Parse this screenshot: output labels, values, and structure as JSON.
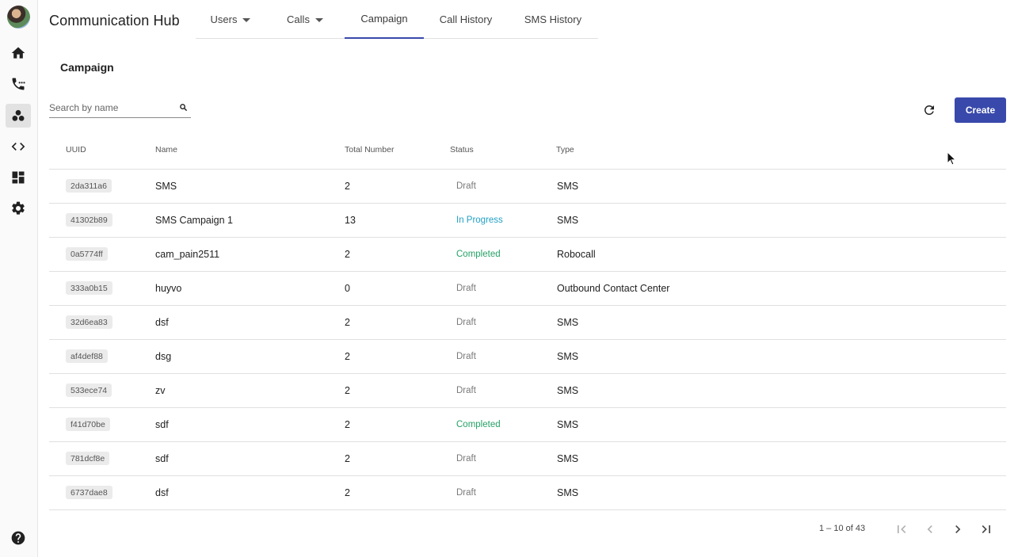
{
  "app": {
    "title": "Communication Hub"
  },
  "sidebar": {
    "items": [
      {
        "icon": "home-icon"
      },
      {
        "icon": "phone-dialpad-icon"
      },
      {
        "icon": "campaign-bubbles-icon"
      },
      {
        "icon": "code-icon"
      },
      {
        "icon": "dashboard-icon"
      },
      {
        "icon": "gear-icon"
      },
      {
        "icon": "help-icon"
      }
    ]
  },
  "tabs": [
    {
      "label": "Users",
      "dropdown": true
    },
    {
      "label": "Calls",
      "dropdown": true
    },
    {
      "label": "Campaign",
      "active": true
    },
    {
      "label": "Call History"
    },
    {
      "label": "SMS History"
    }
  ],
  "page": {
    "title": "Campaign"
  },
  "search": {
    "placeholder": "Search by name",
    "value": ""
  },
  "toolbar": {
    "create_label": "Create"
  },
  "table": {
    "headers": {
      "uuid": "UUID",
      "name": "Name",
      "total": "Total Number",
      "status": "Status",
      "type": "Type"
    },
    "rows": [
      {
        "uuid": "2da311a6",
        "name": "SMS",
        "total": "2",
        "status": "Draft",
        "type": "SMS"
      },
      {
        "uuid": "41302b89",
        "name": "SMS Campaign 1",
        "total": "13",
        "status": "In Progress",
        "type": "SMS"
      },
      {
        "uuid": "0a5774ff",
        "name": "cam_pain2511",
        "total": "2",
        "status": "Completed",
        "type": "Robocall"
      },
      {
        "uuid": "333a0b15",
        "name": "huyvo",
        "total": "0",
        "status": "Draft",
        "type": "Outbound Contact Center"
      },
      {
        "uuid": "32d6ea83",
        "name": "dsf",
        "total": "2",
        "status": "Draft",
        "type": "SMS"
      },
      {
        "uuid": "af4def88",
        "name": "dsg",
        "total": "2",
        "status": "Draft",
        "type": "SMS"
      },
      {
        "uuid": "533ece74",
        "name": "zv",
        "total": "2",
        "status": "Draft",
        "type": "SMS"
      },
      {
        "uuid": "f41d70be",
        "name": "sdf",
        "total": "2",
        "status": "Completed",
        "type": "SMS"
      },
      {
        "uuid": "781dcf8e",
        "name": "sdf",
        "total": "2",
        "status": "Draft",
        "type": "SMS"
      },
      {
        "uuid": "6737dae8",
        "name": "dsf",
        "total": "2",
        "status": "Draft",
        "type": "SMS"
      }
    ]
  },
  "pagination": {
    "range_label": "1 – 10 of 43"
  },
  "colors": {
    "accent": "#3949ab",
    "status_draft": "#7a7a7a",
    "status_in_progress": "#21a0c4",
    "status_completed": "#26a167"
  }
}
